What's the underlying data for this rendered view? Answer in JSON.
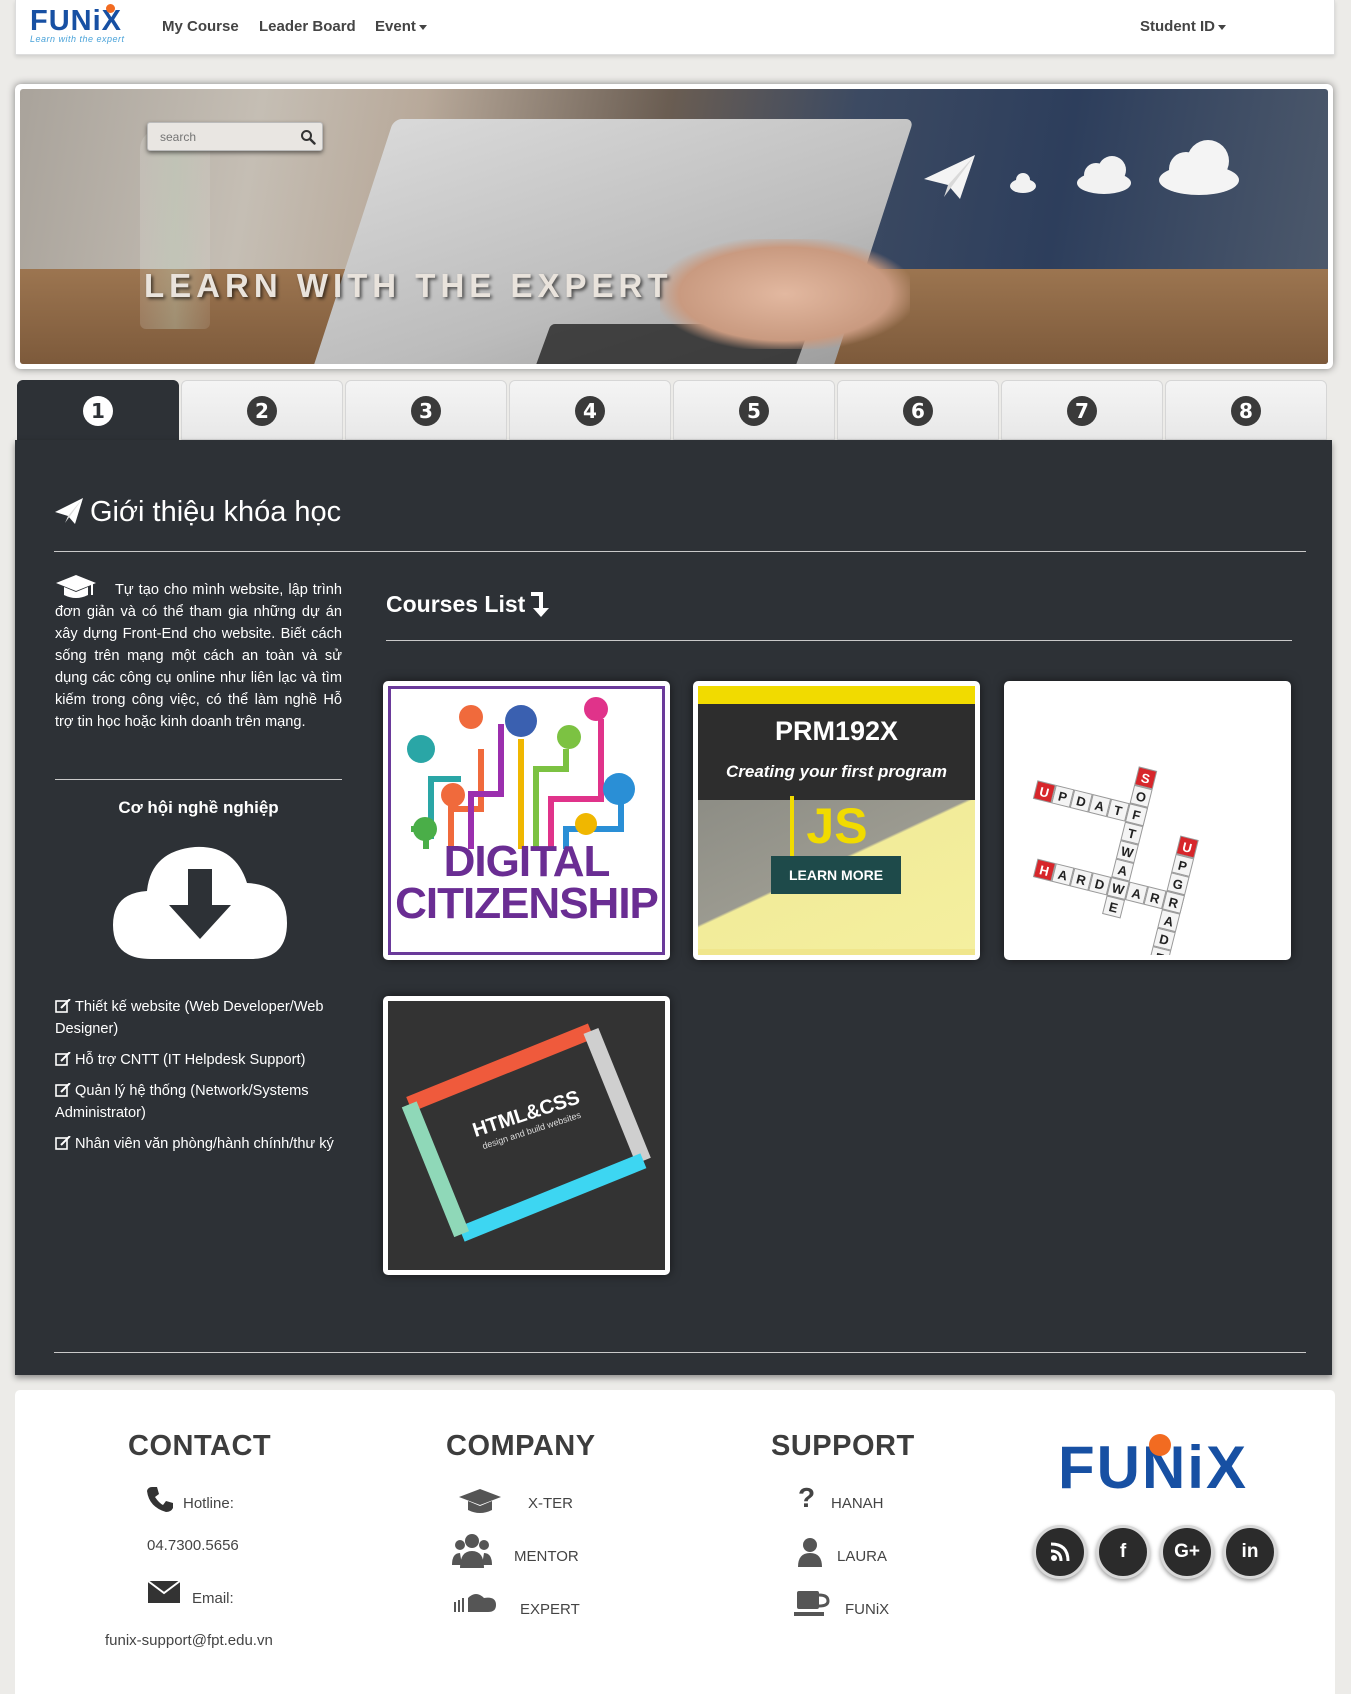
{
  "nav": {
    "brand": "FUNiX",
    "brand_tagline": "Learn with the expert",
    "my_course": "My Course",
    "leader_board": "Leader Board",
    "event": "Event",
    "student_id": "Student ID"
  },
  "banner": {
    "search_placeholder": "search",
    "title": "LEARN WITH THE EXPERT"
  },
  "tabs": [
    "1",
    "2",
    "3",
    "4",
    "5",
    "6",
    "7",
    "8"
  ],
  "active_tab": "1",
  "intro": {
    "title": "Giới thiệu khóa học",
    "text": "Tự tạo cho mình website, lập trình đơn giản và có thể tham gia những dự án xây dựng Front-End cho website. Biết cách sống trên mạng một cách an toàn và sử dụng các công cụ online như liên lạc và tìm kiếm trong công việc, có thể làm nghề Hỗ trợ tin học hoặc kinh doanh trên mạng.",
    "career_title": "Cơ hội nghề nghiệp",
    "jobs": [
      "Thiết kế website (Web Developer/Web Designer)",
      "Hỗ trợ CNTT (IT Helpdesk Support)",
      "Quản lý hệ thống (Network/Systems Administrator)",
      "Nhân viên văn phòng/hành chính/thư ký"
    ]
  },
  "courses": {
    "title": "Courses List",
    "items": [
      {
        "image_text": [
          "DIGITAL",
          "CITIZENSHIP"
        ]
      },
      {
        "code": "PRM192X",
        "subtitle": "Creating your first program",
        "badge": "JS",
        "button": "LEARN MORE"
      },
      {
        "words": [
          "UPDATE",
          "SOFTWARE",
          "HARDWARE",
          "UPGRADE"
        ]
      },
      {
        "title": "HTML&CSS",
        "subtitle": "design and build websites"
      }
    ]
  },
  "footer": {
    "contact": {
      "heading": "CONTACT",
      "hotline_label": "Hotline:",
      "hotline": "04.7300.5656",
      "email_label": "Email:",
      "email": "funix-support@fpt.edu.vn"
    },
    "company": {
      "heading": "COMPANY",
      "items": [
        "X-TER",
        "MENTOR",
        "EXPERT"
      ]
    },
    "support": {
      "heading": "SUPPORT",
      "items": [
        "HANAH",
        "LAURA",
        "FUNiX"
      ]
    },
    "logo": "FUNiX",
    "social": [
      "rss",
      "f",
      "G+",
      "in"
    ]
  },
  "colors": {
    "brand_blue": "#1750a3",
    "brand_orange": "#f26b21",
    "panel_dark": "#2d3136"
  }
}
